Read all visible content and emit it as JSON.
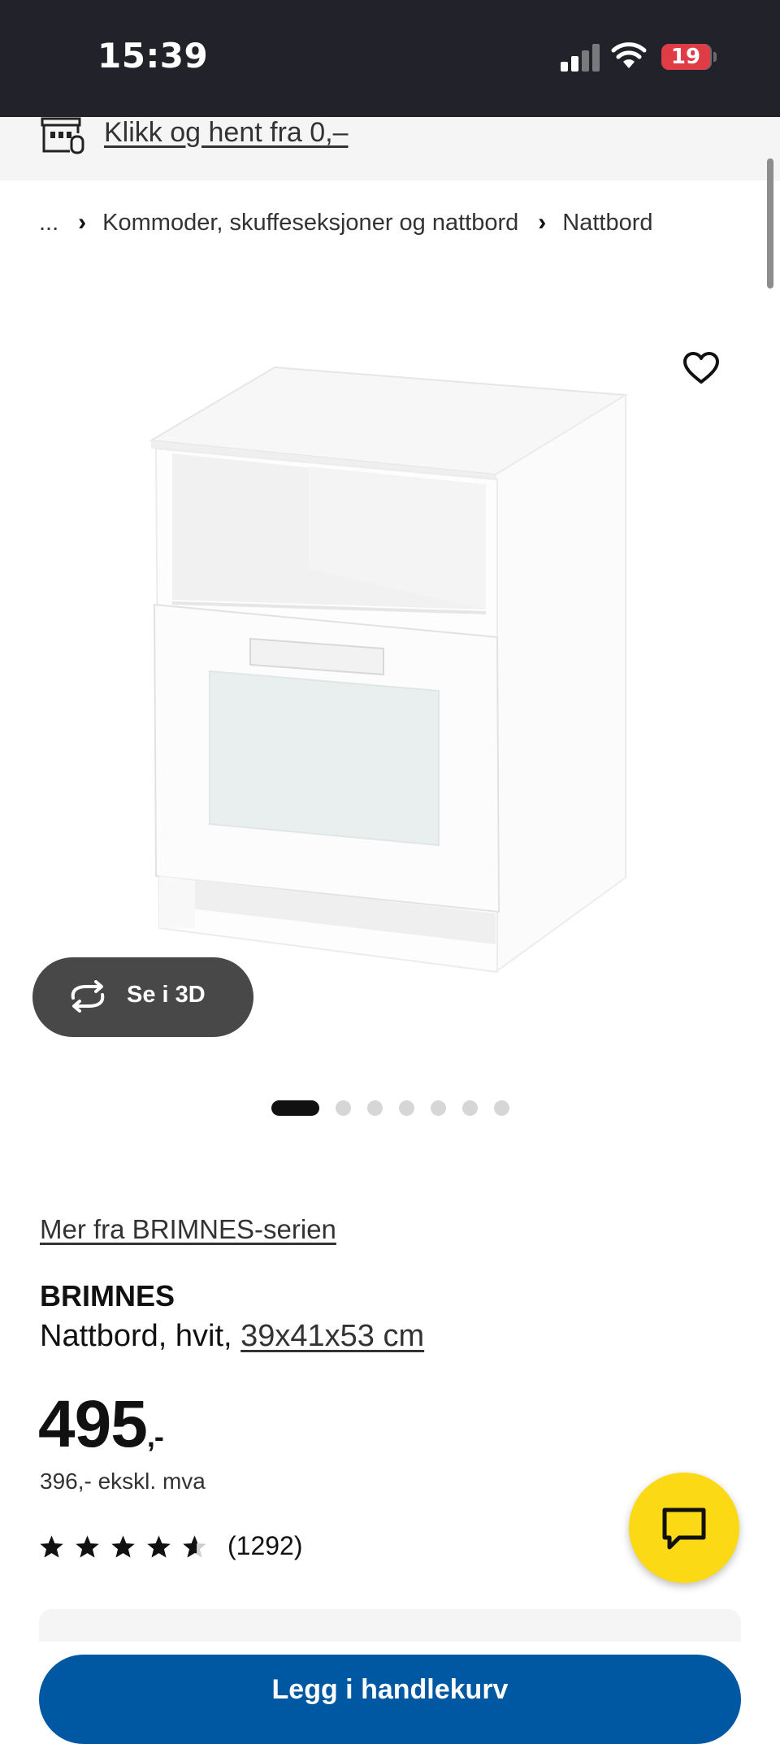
{
  "status_bar": {
    "time": "15:39",
    "battery": "19",
    "icons": [
      "signal-icon",
      "wifi-icon",
      "battery-icon"
    ]
  },
  "pickup_banner": {
    "icon": "store-icon",
    "link_label": "Klikk og hent fra 0,–"
  },
  "breadcrumb": {
    "items": [
      "...",
      "Kommoder, skuffeseksjoner og nattbord",
      "Nattbord"
    ]
  },
  "gallery": {
    "favorite_icon": "heart-icon",
    "view_3d_label": "Se i 3D",
    "view_3d_icon": "rotate-icon",
    "slide_count": 7,
    "active_slide": 1
  },
  "product": {
    "series_link": "Mer fra BRIMNES-serien",
    "name": "BRIMNES",
    "description": "Nattbord, hvit, ",
    "dimensions": "39x41x53 cm",
    "price": "495",
    "price_suffix": ",-",
    "price_ex_vat": "396,- ekskl. mva",
    "rating": 4.5,
    "rating_count": "(1292)"
  },
  "chat": {
    "icon": "chat-icon"
  },
  "buy_button": {
    "label": "Legg i handlekurv"
  },
  "colors": {
    "status_bar_bg": "#22232a",
    "battery_red": "#e03c45",
    "chat_yellow": "#fbd914",
    "primary_blue": "#0058a3"
  }
}
